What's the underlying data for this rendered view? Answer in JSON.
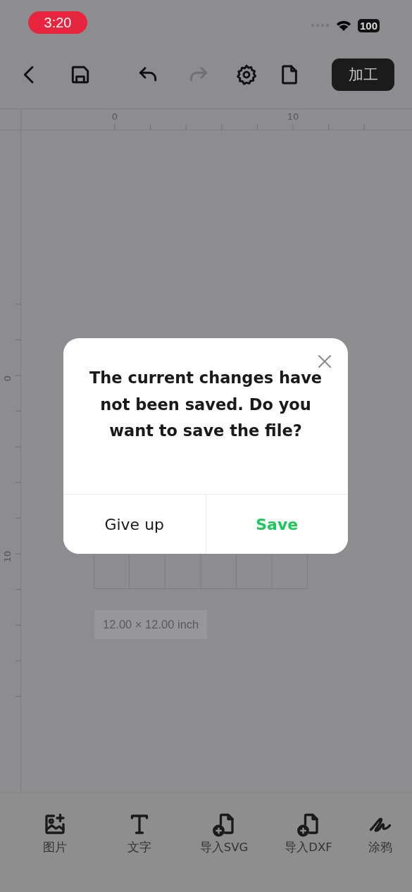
{
  "status_bar": {
    "time": "3:20",
    "battery": "100"
  },
  "toolbar": {
    "items": [
      {
        "kind": "back",
        "disabled": false
      },
      {
        "kind": "save",
        "disabled": false
      },
      {
        "kind": "undo",
        "disabled": false
      },
      {
        "kind": "redo",
        "disabled": true
      },
      {
        "kind": "settings",
        "disabled": false
      },
      {
        "kind": "file",
        "disabled": false
      }
    ],
    "action_button": "加工"
  },
  "ruler_horizontal": {
    "labels": [
      "0",
      "10"
    ]
  },
  "ruler_vertical": {
    "labels": [
      "0",
      "10"
    ]
  },
  "canvas": {
    "size_label": "12.00 × 12.00 inch"
  },
  "dialog": {
    "message": "The current changes have not been saved. Do you want to save the file?",
    "buttons": [
      {
        "label": "Give up",
        "kind": "secondary"
      },
      {
        "label": "Save",
        "kind": "primary"
      }
    ]
  },
  "bottom_tools": [
    {
      "label": "图片",
      "kind": "image"
    },
    {
      "label": "文字",
      "kind": "text"
    },
    {
      "label": "导入SVG",
      "kind": "import"
    },
    {
      "label": "导入DXF",
      "kind": "import"
    },
    {
      "label": "涂鸦",
      "kind": "draw"
    }
  ]
}
